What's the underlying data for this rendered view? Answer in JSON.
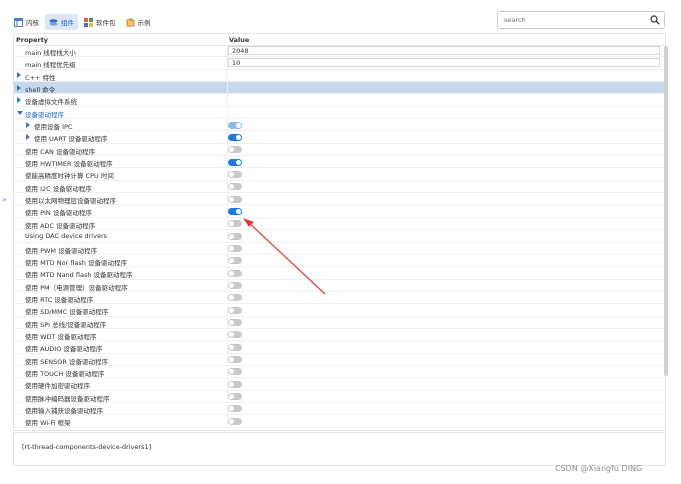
{
  "toolbar": {
    "tabs": [
      {
        "label": "内核",
        "icon": "kernel-icon",
        "active": false
      },
      {
        "label": "组件",
        "icon": "component-icon",
        "active": true
      },
      {
        "label": "软件包",
        "icon": "package-icon",
        "active": false
      },
      {
        "label": "示例",
        "icon": "example-icon",
        "active": false
      }
    ]
  },
  "search": {
    "placeholder": "search"
  },
  "grid": {
    "col_property": "Property",
    "col_value": "Value"
  },
  "rows": [
    {
      "name": "main 线程栈大小",
      "indent": 1,
      "expander": "none",
      "value_type": "text",
      "value": "2048"
    },
    {
      "name": "main 线程优先级",
      "indent": 1,
      "expander": "none",
      "value_type": "text",
      "value": "10"
    },
    {
      "name": "C++ 特性",
      "indent": 0,
      "expander": "right",
      "value_type": "none"
    },
    {
      "name": "shell 命令",
      "indent": 0,
      "expander": "right",
      "value_type": "none",
      "selected": true
    },
    {
      "name": "设备虚拟文件系统",
      "indent": 0,
      "expander": "right",
      "value_type": "none"
    },
    {
      "name": "设备驱动程序",
      "indent": 0,
      "expander": "down",
      "value_type": "none",
      "blue": true
    },
    {
      "name": "使用设备 IPC",
      "indent": 1,
      "expander": "right",
      "value_type": "toggle",
      "state": "light"
    },
    {
      "name": "使用 UART 设备驱动程序",
      "indent": 1,
      "expander": "right",
      "value_type": "toggle",
      "state": "on"
    },
    {
      "name": "使用 CAN 设备驱动程序",
      "indent": 1,
      "expander": "none",
      "value_type": "toggle",
      "state": "off"
    },
    {
      "name": "使用 HWTIMER 设备驱动程序",
      "indent": 1,
      "expander": "none",
      "value_type": "toggle",
      "state": "on"
    },
    {
      "name": "使能高精度时钟计算 CPU 时间",
      "indent": 1,
      "expander": "none",
      "value_type": "toggle",
      "state": "off"
    },
    {
      "name": "使用 I2C 设备驱动程序",
      "indent": 1,
      "expander": "none",
      "value_type": "toggle",
      "state": "off"
    },
    {
      "name": "使用以太网物理层设备驱动程序",
      "indent": 1,
      "expander": "none",
      "value_type": "toggle",
      "state": "off"
    },
    {
      "name": "使用 PIN 设备驱动程序",
      "indent": 1,
      "expander": "none",
      "value_type": "toggle",
      "state": "on"
    },
    {
      "name": "使用 ADC 设备驱动程序",
      "indent": 1,
      "expander": "none",
      "value_type": "toggle",
      "state": "off"
    },
    {
      "name": "Using DAC device drivers",
      "indent": 1,
      "expander": "none",
      "value_type": "toggle",
      "state": "off"
    },
    {
      "name": "使用 PWM 设备驱动程序",
      "indent": 1,
      "expander": "none",
      "value_type": "toggle",
      "state": "off"
    },
    {
      "name": "使用 MTD Nor flash 设备驱动程序",
      "indent": 1,
      "expander": "none",
      "value_type": "toggle",
      "state": "off"
    },
    {
      "name": "使用 MTD Nand flash 设备驱动程序",
      "indent": 1,
      "expander": "none",
      "value_type": "toggle",
      "state": "off"
    },
    {
      "name": "使用 PM（电源管理）设备驱动程序",
      "indent": 1,
      "expander": "none",
      "value_type": "toggle",
      "state": "off"
    },
    {
      "name": "使用 RTC 设备驱动程序",
      "indent": 1,
      "expander": "none",
      "value_type": "toggle",
      "state": "off"
    },
    {
      "name": "使用 SD/MMC 设备驱动程序",
      "indent": 1,
      "expander": "none",
      "value_type": "toggle",
      "state": "off"
    },
    {
      "name": "使用 SPI 总线/设备驱动程序",
      "indent": 1,
      "expander": "none",
      "value_type": "toggle",
      "state": "off"
    },
    {
      "name": "使用 WDT 设备驱动程序",
      "indent": 1,
      "expander": "none",
      "value_type": "toggle",
      "state": "off"
    },
    {
      "name": "使用 AUDIO 设备驱动程序",
      "indent": 1,
      "expander": "none",
      "value_type": "toggle",
      "state": "off"
    },
    {
      "name": "使用 SENSOR 设备驱动程序",
      "indent": 1,
      "expander": "none",
      "value_type": "toggle",
      "state": "off"
    },
    {
      "name": "使用 TOUCH 设备驱动程序",
      "indent": 1,
      "expander": "none",
      "value_type": "toggle",
      "state": "off"
    },
    {
      "name": "使用硬件加密驱动程序",
      "indent": 1,
      "expander": "none",
      "value_type": "toggle",
      "state": "off"
    },
    {
      "name": "使用脉冲编码器设备驱动程序",
      "indent": 1,
      "expander": "none",
      "value_type": "toggle",
      "state": "off"
    },
    {
      "name": "使用输入捕获设备驱动程序",
      "indent": 1,
      "expander": "none",
      "value_type": "toggle",
      "state": "off"
    },
    {
      "name": "使用 Wi-Fi 框架",
      "indent": 1,
      "expander": "none",
      "value_type": "toggle",
      "state": "off"
    }
  ],
  "description": "[rt-thread-components-device-drivers1]",
  "side_toggle": "»",
  "watermark": "CSDN @Xiangfu DING",
  "colors": {
    "accent": "#1f7be0",
    "selected_row": "#c6d8ee",
    "annotation_arrow": "#e53935"
  }
}
